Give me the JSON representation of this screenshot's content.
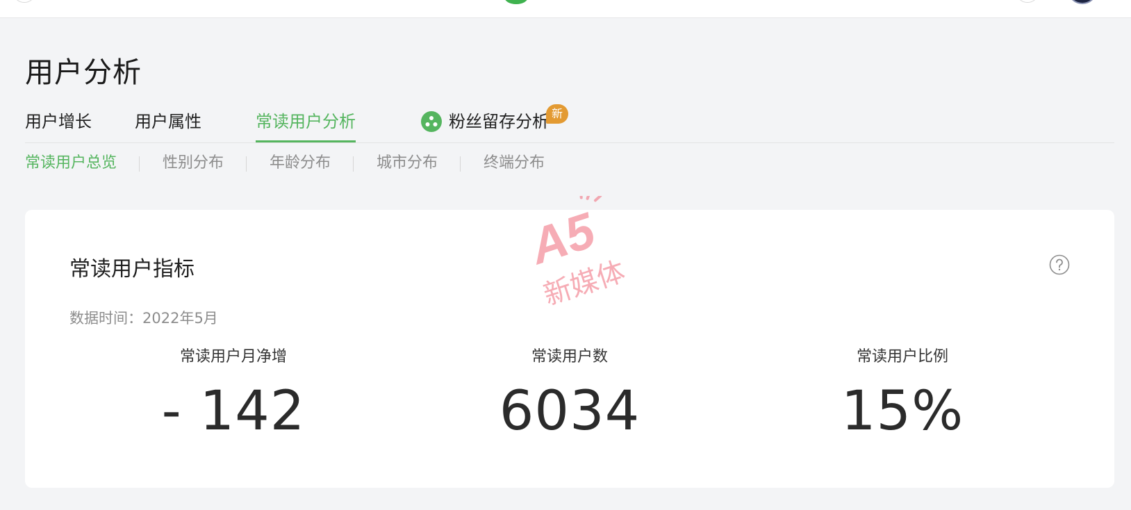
{
  "header": {
    "page_title": "用户分析"
  },
  "tabs": [
    {
      "label": "用户增长",
      "active": false
    },
    {
      "label": "用户属性",
      "active": false
    },
    {
      "label": "常读用户分析",
      "active": true
    },
    {
      "label": "粉丝留存分析",
      "active": false,
      "icon": "retention-icon",
      "badge": "新"
    }
  ],
  "subtabs": [
    {
      "label": "常读用户总览",
      "active": true
    },
    {
      "label": "性别分布",
      "active": false
    },
    {
      "label": "年龄分布",
      "active": false
    },
    {
      "label": "城市分布",
      "active": false
    },
    {
      "label": "终端分布",
      "active": false
    }
  ],
  "card": {
    "title": "常读用户指标",
    "data_time": "数据时间：2022年5月",
    "metrics": [
      {
        "label": "常读用户月净增",
        "value": "- 142"
      },
      {
        "label": "常读用户数",
        "value": "6034"
      },
      {
        "label": "常读用户比例",
        "value": "15%"
      }
    ]
  },
  "watermark": {
    "text_mark": "A5",
    "text_sub": "新媒体"
  },
  "colors": {
    "accent": "#55b55f",
    "badge": "#e39a32",
    "background": "#f3f4f6",
    "card": "#ffffff",
    "watermark": "#f06a7a"
  }
}
